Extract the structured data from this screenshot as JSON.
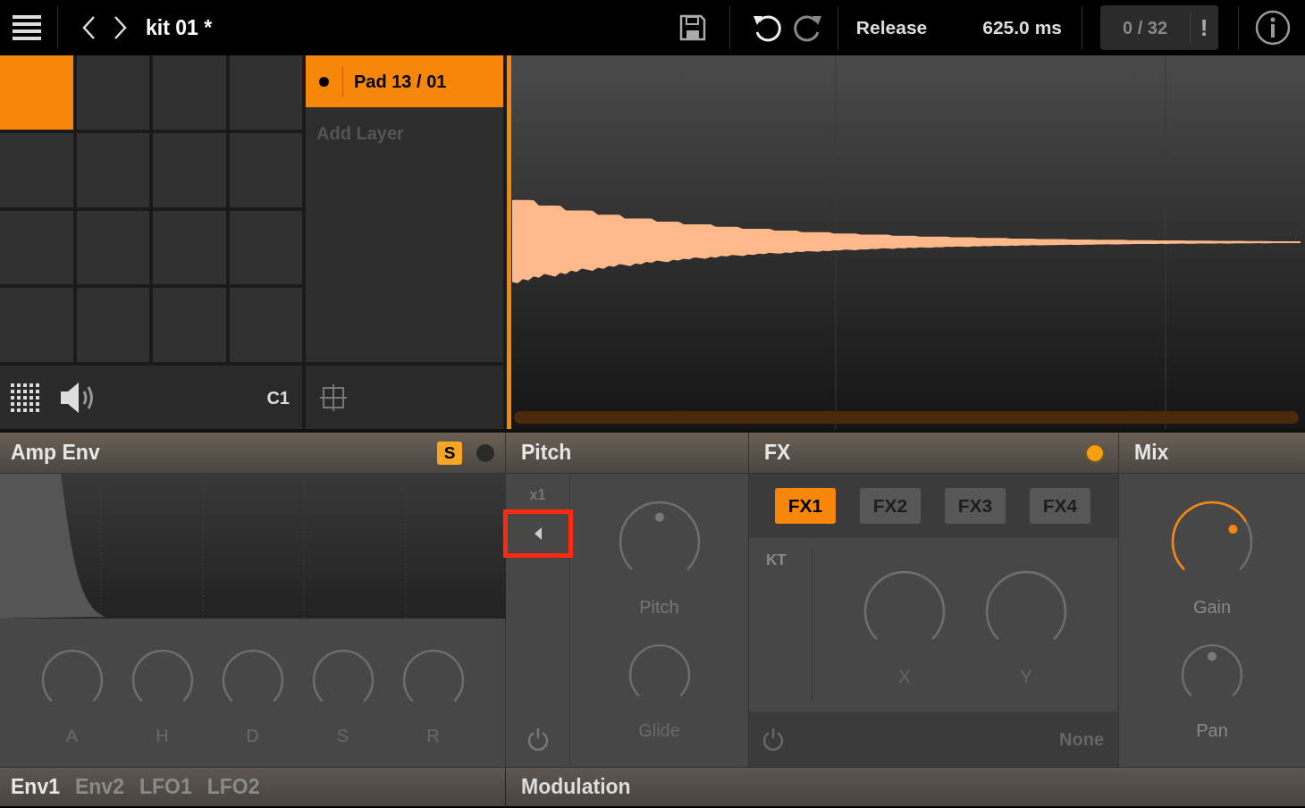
{
  "toolbar": {
    "kit_name": "kit 01 *",
    "parameter_name": "Release",
    "parameter_value": "625.0 ms",
    "counter": "0 / 32",
    "alert": "!"
  },
  "pads": [
    {
      "selected": true
    },
    {
      "selected": false
    },
    {
      "selected": false
    },
    {
      "selected": false
    },
    {
      "selected": false
    },
    {
      "selected": false
    },
    {
      "selected": false
    },
    {
      "selected": false
    },
    {
      "selected": false
    },
    {
      "selected": false
    },
    {
      "selected": false
    },
    {
      "selected": false
    },
    {
      "selected": false
    },
    {
      "selected": false
    },
    {
      "selected": false
    },
    {
      "selected": false
    }
  ],
  "pad_footer": {
    "note": "C1"
  },
  "layers": [
    {
      "label": "Pad 13 / 01",
      "selected": true
    }
  ],
  "add_layer": "Add Layer",
  "amp_env": {
    "title": "Amp Env",
    "solo": {
      "label": "S",
      "on": true
    },
    "led_on": false,
    "knobs": [
      {
        "label": "A",
        "kind": "plain"
      },
      {
        "label": "H",
        "kind": "plain"
      },
      {
        "label": "D",
        "kind": "plain"
      },
      {
        "label": "S",
        "kind": "plain"
      },
      {
        "label": "R",
        "kind": "plain"
      }
    ]
  },
  "tabs": [
    {
      "label": "Env1",
      "selected": true
    },
    {
      "label": "Env2",
      "selected": false
    },
    {
      "label": "LFO1",
      "selected": false
    },
    {
      "label": "LFO2",
      "selected": false
    }
  ],
  "pitch": {
    "title": "Pitch",
    "multiplier": "x1",
    "knobs": [
      {
        "label": "Pitch",
        "kind": "dot"
      },
      {
        "label": "Glide",
        "kind": "plain"
      }
    ]
  },
  "fx": {
    "title": "FX",
    "led_on": true,
    "slots": [
      {
        "label": "FX1",
        "selected": true
      },
      {
        "label": "FX2",
        "selected": false
      },
      {
        "label": "FX3",
        "selected": false
      },
      {
        "label": "FX4",
        "selected": false
      }
    ],
    "kt": "KT",
    "knobs": [
      {
        "label": "X",
        "kind": "plain"
      },
      {
        "label": "Y",
        "kind": "plain"
      }
    ],
    "type": "None"
  },
  "mix": {
    "title": "Mix",
    "knobs": [
      {
        "label": "Gain",
        "kind": "active"
      },
      {
        "label": "Pan",
        "kind": "dot"
      }
    ]
  },
  "modulation": {
    "title": "Modulation"
  }
}
